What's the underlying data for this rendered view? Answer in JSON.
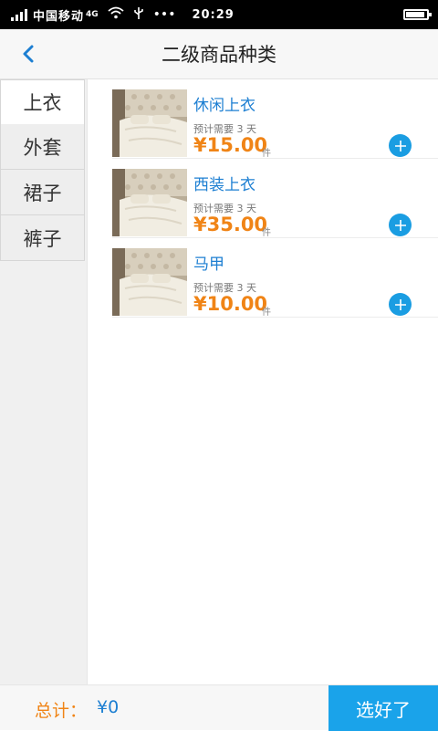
{
  "status_bar": {
    "carrier": "中国移动",
    "network": "4G",
    "time": "20:29",
    "battery_level": 0.85,
    "icons": [
      "signal-icon",
      "wifi-icon",
      "usb-icon",
      "more-icon",
      "battery-icon"
    ]
  },
  "header": {
    "title": "二级商品种类",
    "back_icon": "back-arrow-icon"
  },
  "sidebar": {
    "items": [
      {
        "label": "上衣",
        "active": true
      },
      {
        "label": "外套",
        "active": false
      },
      {
        "label": "裙子",
        "active": false
      },
      {
        "label": "裤子",
        "active": false
      }
    ]
  },
  "products": [
    {
      "name": "休闲上衣",
      "eta": "预计需要 3 天",
      "price": "¥15.00",
      "unit": "件"
    },
    {
      "name": "西装上衣",
      "eta": "预计需要 3 天",
      "price": "¥35.00",
      "unit": "件"
    },
    {
      "name": "马甲",
      "eta": "预计需要 3 天",
      "price": "¥10.00",
      "unit": "件"
    }
  ],
  "footer": {
    "total_label": "总计：",
    "total_value": "¥0",
    "confirm_label": "选好了"
  },
  "colors": {
    "accent_blue": "#1aa3ea",
    "price_orange": "#f08416",
    "link_blue": "#1d7fd2"
  }
}
